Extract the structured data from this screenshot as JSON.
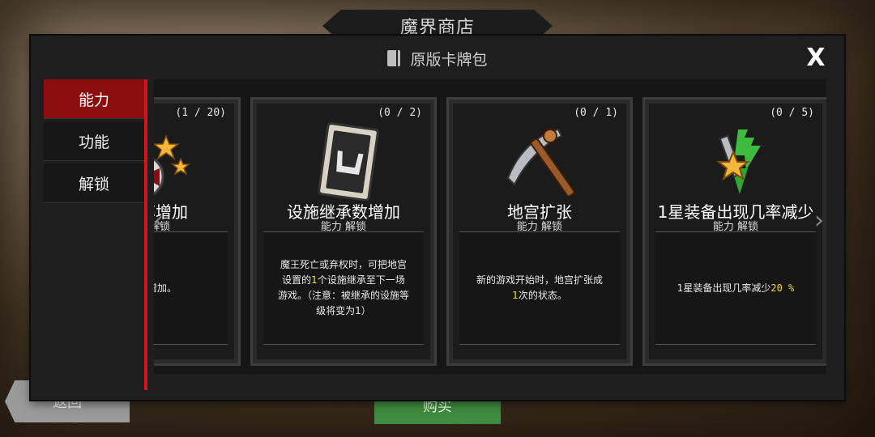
{
  "shop_title": "魔界商店",
  "back_label": "返回",
  "buy_label": "购买",
  "panel": {
    "title": "原版卡牌包",
    "pack_icon": "card-pack-icon",
    "close_label": "X"
  },
  "sidebar": {
    "tabs": [
      {
        "label": "能力",
        "active": true
      },
      {
        "label": "功能",
        "active": false
      },
      {
        "label": "解锁",
        "active": false
      }
    ]
  },
  "colors": {
    "accent_red": "#d3141a",
    "active_tab": "#8c0d0d",
    "highlight": "#f5d542"
  },
  "cards": [
    {
      "count": "(1 / 20)",
      "name": "现几率增加",
      "category": "能力 解锁",
      "desc": "现几率增加。",
      "icon": "star-equipment-icon"
    },
    {
      "count": "(0 / 2)",
      "name": "设施继承数增加",
      "category": "能力 解锁",
      "desc_pre": "魔王死亡或弃权时，可把地宫设置的",
      "desc_hl": "1",
      "desc_post": "个设施继承至下一场游戏。（注意：被继承的设施等级将变为1）",
      "icon": "facility-card-icon"
    },
    {
      "count": "(0 / 1)",
      "name": "地宫扩张",
      "category": "能力 解锁",
      "desc_pre": "新的游戏开始时，地宫扩张成",
      "desc_hl": "1",
      "desc_post": "次的状态。",
      "icon": "pickaxe-icon"
    },
    {
      "count": "(0 / 5)",
      "name": "1星装备出现几率减少",
      "category": "能力 解锁",
      "desc_pre": "1星装备出现几率减少",
      "desc_hl": "20 %",
      "desc_post": "",
      "icon": "star-sword-down-icon"
    }
  ]
}
